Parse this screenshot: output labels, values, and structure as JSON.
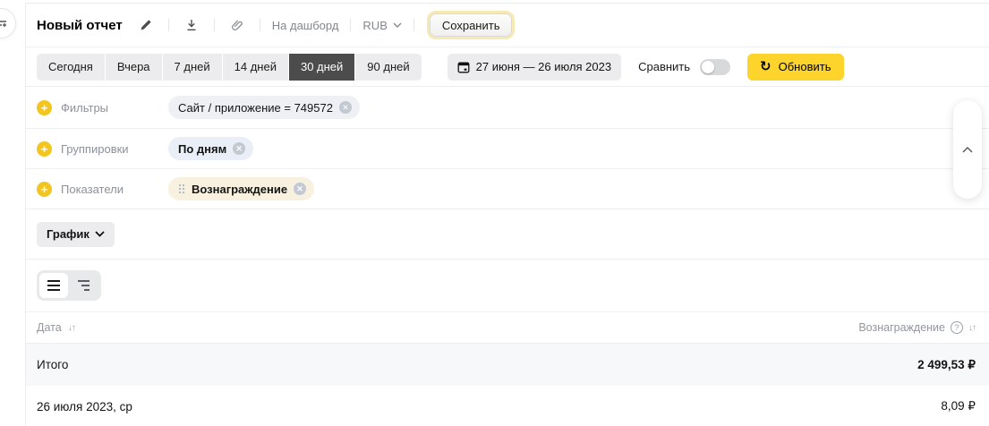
{
  "colors": {
    "accent_yellow": "#fdd42c",
    "save_button_ring": "#f7e9b4",
    "selected_preset_bg": "#4c4c4c",
    "chip_filter_bg": "#eef0f3",
    "chip_grouping_bg": "#e9eef7",
    "chip_metric_bg": "#f8f1e0",
    "total_row_bg": "#f7f8f9",
    "muted_text": "#8c919a"
  },
  "header": {
    "title": "Новый отчет",
    "dashboard_link": "На дашборд",
    "currency": "RUB",
    "save_label": "Сохранить"
  },
  "date_controls": {
    "presets": [
      {
        "label": "Сегодня"
      },
      {
        "label": "Вчера"
      },
      {
        "label": "7 дней"
      },
      {
        "label": "14 дней"
      },
      {
        "label": "30 дней",
        "selected": true
      },
      {
        "label": "90 дней"
      }
    ],
    "range": "27 июня — 26 июля 2023",
    "compare_label": "Сравнить",
    "compare_state": "off",
    "refresh_label": "Обновить"
  },
  "config": {
    "filters": {
      "label": "Фильтры",
      "chip": "Сайт / приложение = 749572"
    },
    "groupings": {
      "label": "Группировки",
      "chip": "По дням"
    },
    "metrics": {
      "label": "Показатели",
      "chip": "Вознаграждение"
    }
  },
  "chart_section": {
    "selector_label": "График"
  },
  "table": {
    "columns": {
      "date": "Дата",
      "reward": "Вознаграждение"
    },
    "total": {
      "label": "Итого",
      "value": "2 499,53 ₽"
    },
    "rows": [
      {
        "date": "26 июля 2023, ср",
        "value": "8,09 ₽"
      }
    ]
  }
}
